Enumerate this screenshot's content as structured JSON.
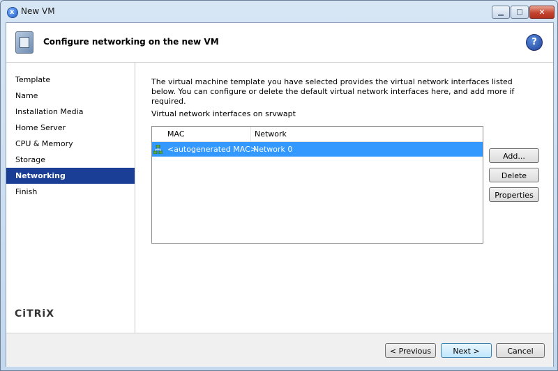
{
  "window": {
    "title": "New VM"
  },
  "header": {
    "title": "Configure networking on the new VM",
    "help_glyph": "?"
  },
  "nav": {
    "items": [
      {
        "label": "Template",
        "active": false
      },
      {
        "label": "Name",
        "active": false
      },
      {
        "label": "Installation Media",
        "active": false
      },
      {
        "label": "Home Server",
        "active": false
      },
      {
        "label": "CPU & Memory",
        "active": false
      },
      {
        "label": "Storage",
        "active": false
      },
      {
        "label": "Networking",
        "active": true
      },
      {
        "label": "Finish",
        "active": false
      }
    ],
    "logo": "CiTRiX"
  },
  "content": {
    "description": "The virtual machine template you have selected provides the virtual network interfaces listed below. You can configure or delete the default virtual network interfaces here, and add more if required.",
    "list_label": "Virtual network interfaces on srvwapt",
    "columns": {
      "mac": "MAC",
      "network": "Network"
    },
    "rows": [
      {
        "mac": "<autogenerated MAC>",
        "network": "Network 0",
        "selected": true
      }
    ],
    "buttons": {
      "add": "Add...",
      "delete": "Delete",
      "properties": "Properties"
    }
  },
  "footer": {
    "previous": "< Previous",
    "next": "Next >",
    "cancel": "Cancel"
  },
  "colors": {
    "active_nav_bg": "#1a3e95",
    "selection_bg": "#3399ff"
  }
}
